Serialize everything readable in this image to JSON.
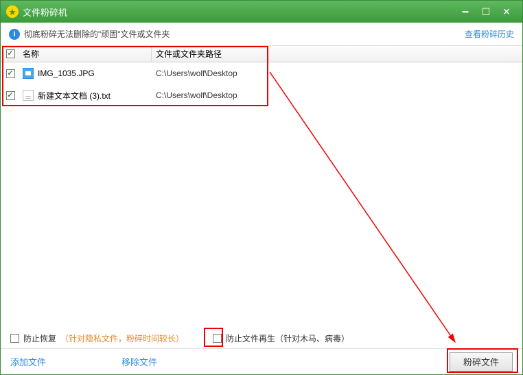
{
  "titlebar": {
    "title": "文件粉碎机"
  },
  "infobar": {
    "text": "彻底粉碎无法删除的\"顽固\"文件或文件夹",
    "history": "查看粉碎历史"
  },
  "table": {
    "headers": {
      "name": "名称",
      "path": "文件或文件夹路径"
    },
    "rows": [
      {
        "checked": true,
        "icon": "img",
        "name": "IMG_1035.JPG",
        "path": "C:\\Users\\wolf\\Desktop"
      },
      {
        "checked": true,
        "icon": "txt",
        "name": "新建文本文档 (3).txt",
        "path": "C:\\Users\\wolf\\Desktop"
      }
    ]
  },
  "options": {
    "prevent_recovery_label": "防止恢复",
    "prevent_recovery_hint": "（针对隐私文件，粉碎时间较长）",
    "prevent_regen_label": "防止文件再生（针对木马、病毒）"
  },
  "footer": {
    "add": "添加文件",
    "remove": "移除文件",
    "shred": "粉碎文件"
  }
}
